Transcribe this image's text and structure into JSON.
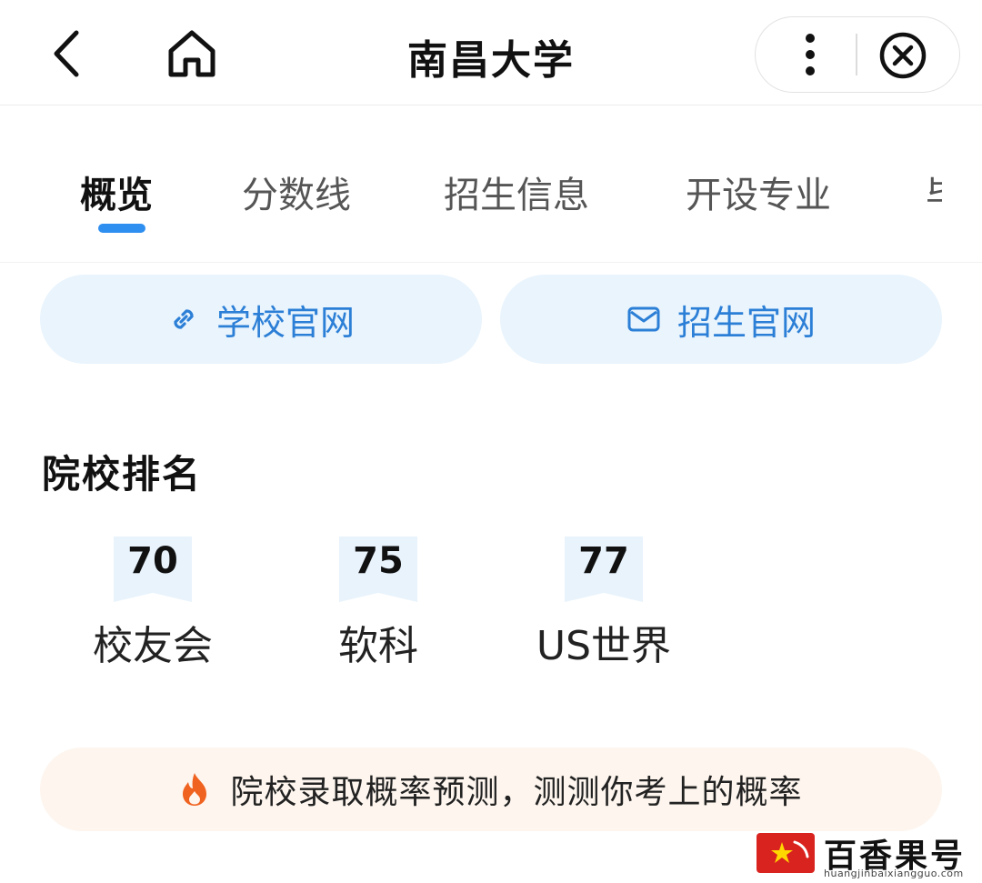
{
  "header": {
    "title": "南昌大学",
    "back_icon": "chevron-left-icon",
    "home_icon": "home-icon",
    "more_icon": "vertical-dots-icon",
    "close_icon": "close-circle-icon"
  },
  "tabs": [
    {
      "label": "概览",
      "active": true
    },
    {
      "label": "分数线",
      "active": false
    },
    {
      "label": "招生信息",
      "active": false
    },
    {
      "label": "开设专业",
      "active": false
    },
    {
      "label": "毕",
      "active": false
    }
  ],
  "links": {
    "school_site": {
      "label": "学校官网",
      "icon": "link-icon"
    },
    "admission_site": {
      "label": "招生官网",
      "icon": "mail-icon"
    }
  },
  "rankings": {
    "title": "院校排名",
    "items": [
      {
        "value": "70",
        "label": "校友会"
      },
      {
        "value": "75",
        "label": "软科"
      },
      {
        "value": "77",
        "label": "US世界"
      }
    ]
  },
  "prediction": {
    "text": "院校录取概率预测，测测你考上的概率",
    "icon": "flame-icon"
  },
  "watermark": {
    "brand": "百香果号",
    "domain": "huangjinbaixiangguo.com"
  },
  "colors": {
    "accent": "#2f8ff0",
    "link_text": "#2c7fd6",
    "link_bg": "#e9f4fd",
    "flame": "#f0621f",
    "banner_bg": "#fdf5ee"
  }
}
